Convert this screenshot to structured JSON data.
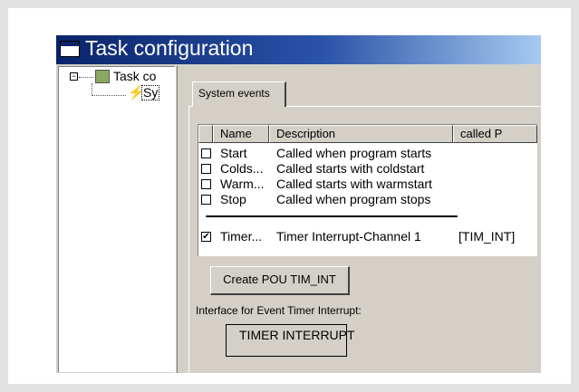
{
  "window": {
    "title": "Task configuration"
  },
  "tree": {
    "root_expander": "⊟",
    "root_label": "Task co",
    "child_label": "Sy",
    "child_icon": "lightning-bolt-icon"
  },
  "tabs": [
    {
      "label": "System events"
    }
  ],
  "table": {
    "columns": [
      "Name",
      "Description",
      "called P"
    ],
    "rows": [
      {
        "checked": false,
        "name": "Start",
        "description": "Called when program starts",
        "called": ""
      },
      {
        "checked": false,
        "name": "Colds...",
        "description": "Called starts with coldstart",
        "called": ""
      },
      {
        "checked": false,
        "name": "Warm...",
        "description": "Called starts with warmstart",
        "called": ""
      },
      {
        "checked": false,
        "name": "Stop",
        "description": "Called when program stops",
        "called": ""
      }
    ],
    "highlighted_row": {
      "checked": true,
      "name": "Timer...",
      "description": "Timer Interrupt-Channel 1",
      "called": "[TIM_INT]"
    }
  },
  "create_button": {
    "label": "Create POU TIM_INT"
  },
  "interface": {
    "label": "Interface for Event Timer Interrupt:",
    "box_text": "TIMER INTERRUPT"
  },
  "colors": {
    "titlebar_start": "#0a246a",
    "titlebar_end": "#a6caf0",
    "dialog_face": "#d4d0c8",
    "frame": "#e2e2e2"
  }
}
